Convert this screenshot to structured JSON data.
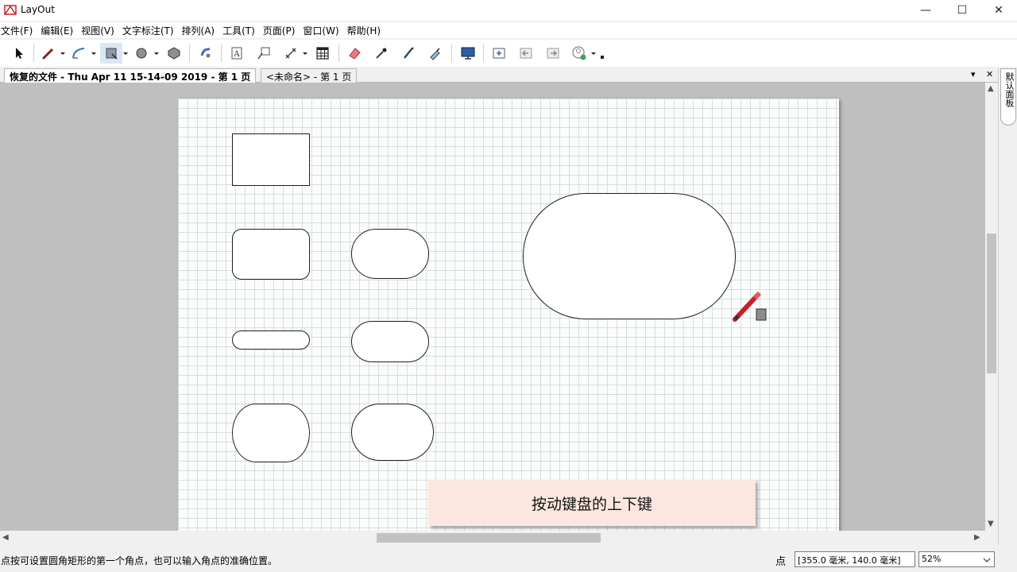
{
  "app": {
    "title": "LayOut"
  },
  "window_controls": {
    "minimize": "—",
    "maximize": "☐",
    "close": "✕"
  },
  "menu": [
    "文件(F)",
    "编辑(E)",
    "视图(V)",
    "文字标注(T)",
    "排列(A)",
    "工具(T)",
    "页面(P)",
    "窗口(W)",
    "帮助(H)"
  ],
  "toolbar": {
    "icons": [
      "select-arrow-icon",
      "pencil-line-icon",
      "freehand-arc-icon",
      "rectangle-tool-icon",
      "circle-tool-icon",
      "polygon-tool-icon",
      "style-sampler-icon",
      "text-tool-icon",
      "label-tool-icon",
      "dimension-tool-icon",
      "table-tool-icon",
      "eraser-icon",
      "eyedropper-icon",
      "paint-bucket-icon",
      "split-icon",
      "presentation-icon",
      "add-page-icon",
      "previous-page-icon",
      "next-page-icon",
      "settings-icon"
    ]
  },
  "tabs": [
    {
      "label": "恢复的文件 - Thu Apr 11 15-14-09 2019 - 第 1 页",
      "active": true
    },
    {
      "label": "<未命名> - 第 1 页",
      "active": false
    }
  ],
  "tab_controls": {
    "dropdown": "▾",
    "close": "✕"
  },
  "tray": {
    "label": "默认面板"
  },
  "canvas": {
    "caption": "按动键盘的上下键"
  },
  "status": {
    "message": "点按可设置圆角矩形的第一个角点，也可以输入角点的准确位置。",
    "units_label": "点",
    "measurement": "[355.0 毫米, 140.0 毫米]",
    "zoom": "52%"
  },
  "colors": {
    "page": "#fbfcfc",
    "grid": "#d7dede",
    "canvas_bg": "#bfbfbf",
    "caption_bg": "#fbe7df",
    "pencil_red": "#c8202a"
  }
}
